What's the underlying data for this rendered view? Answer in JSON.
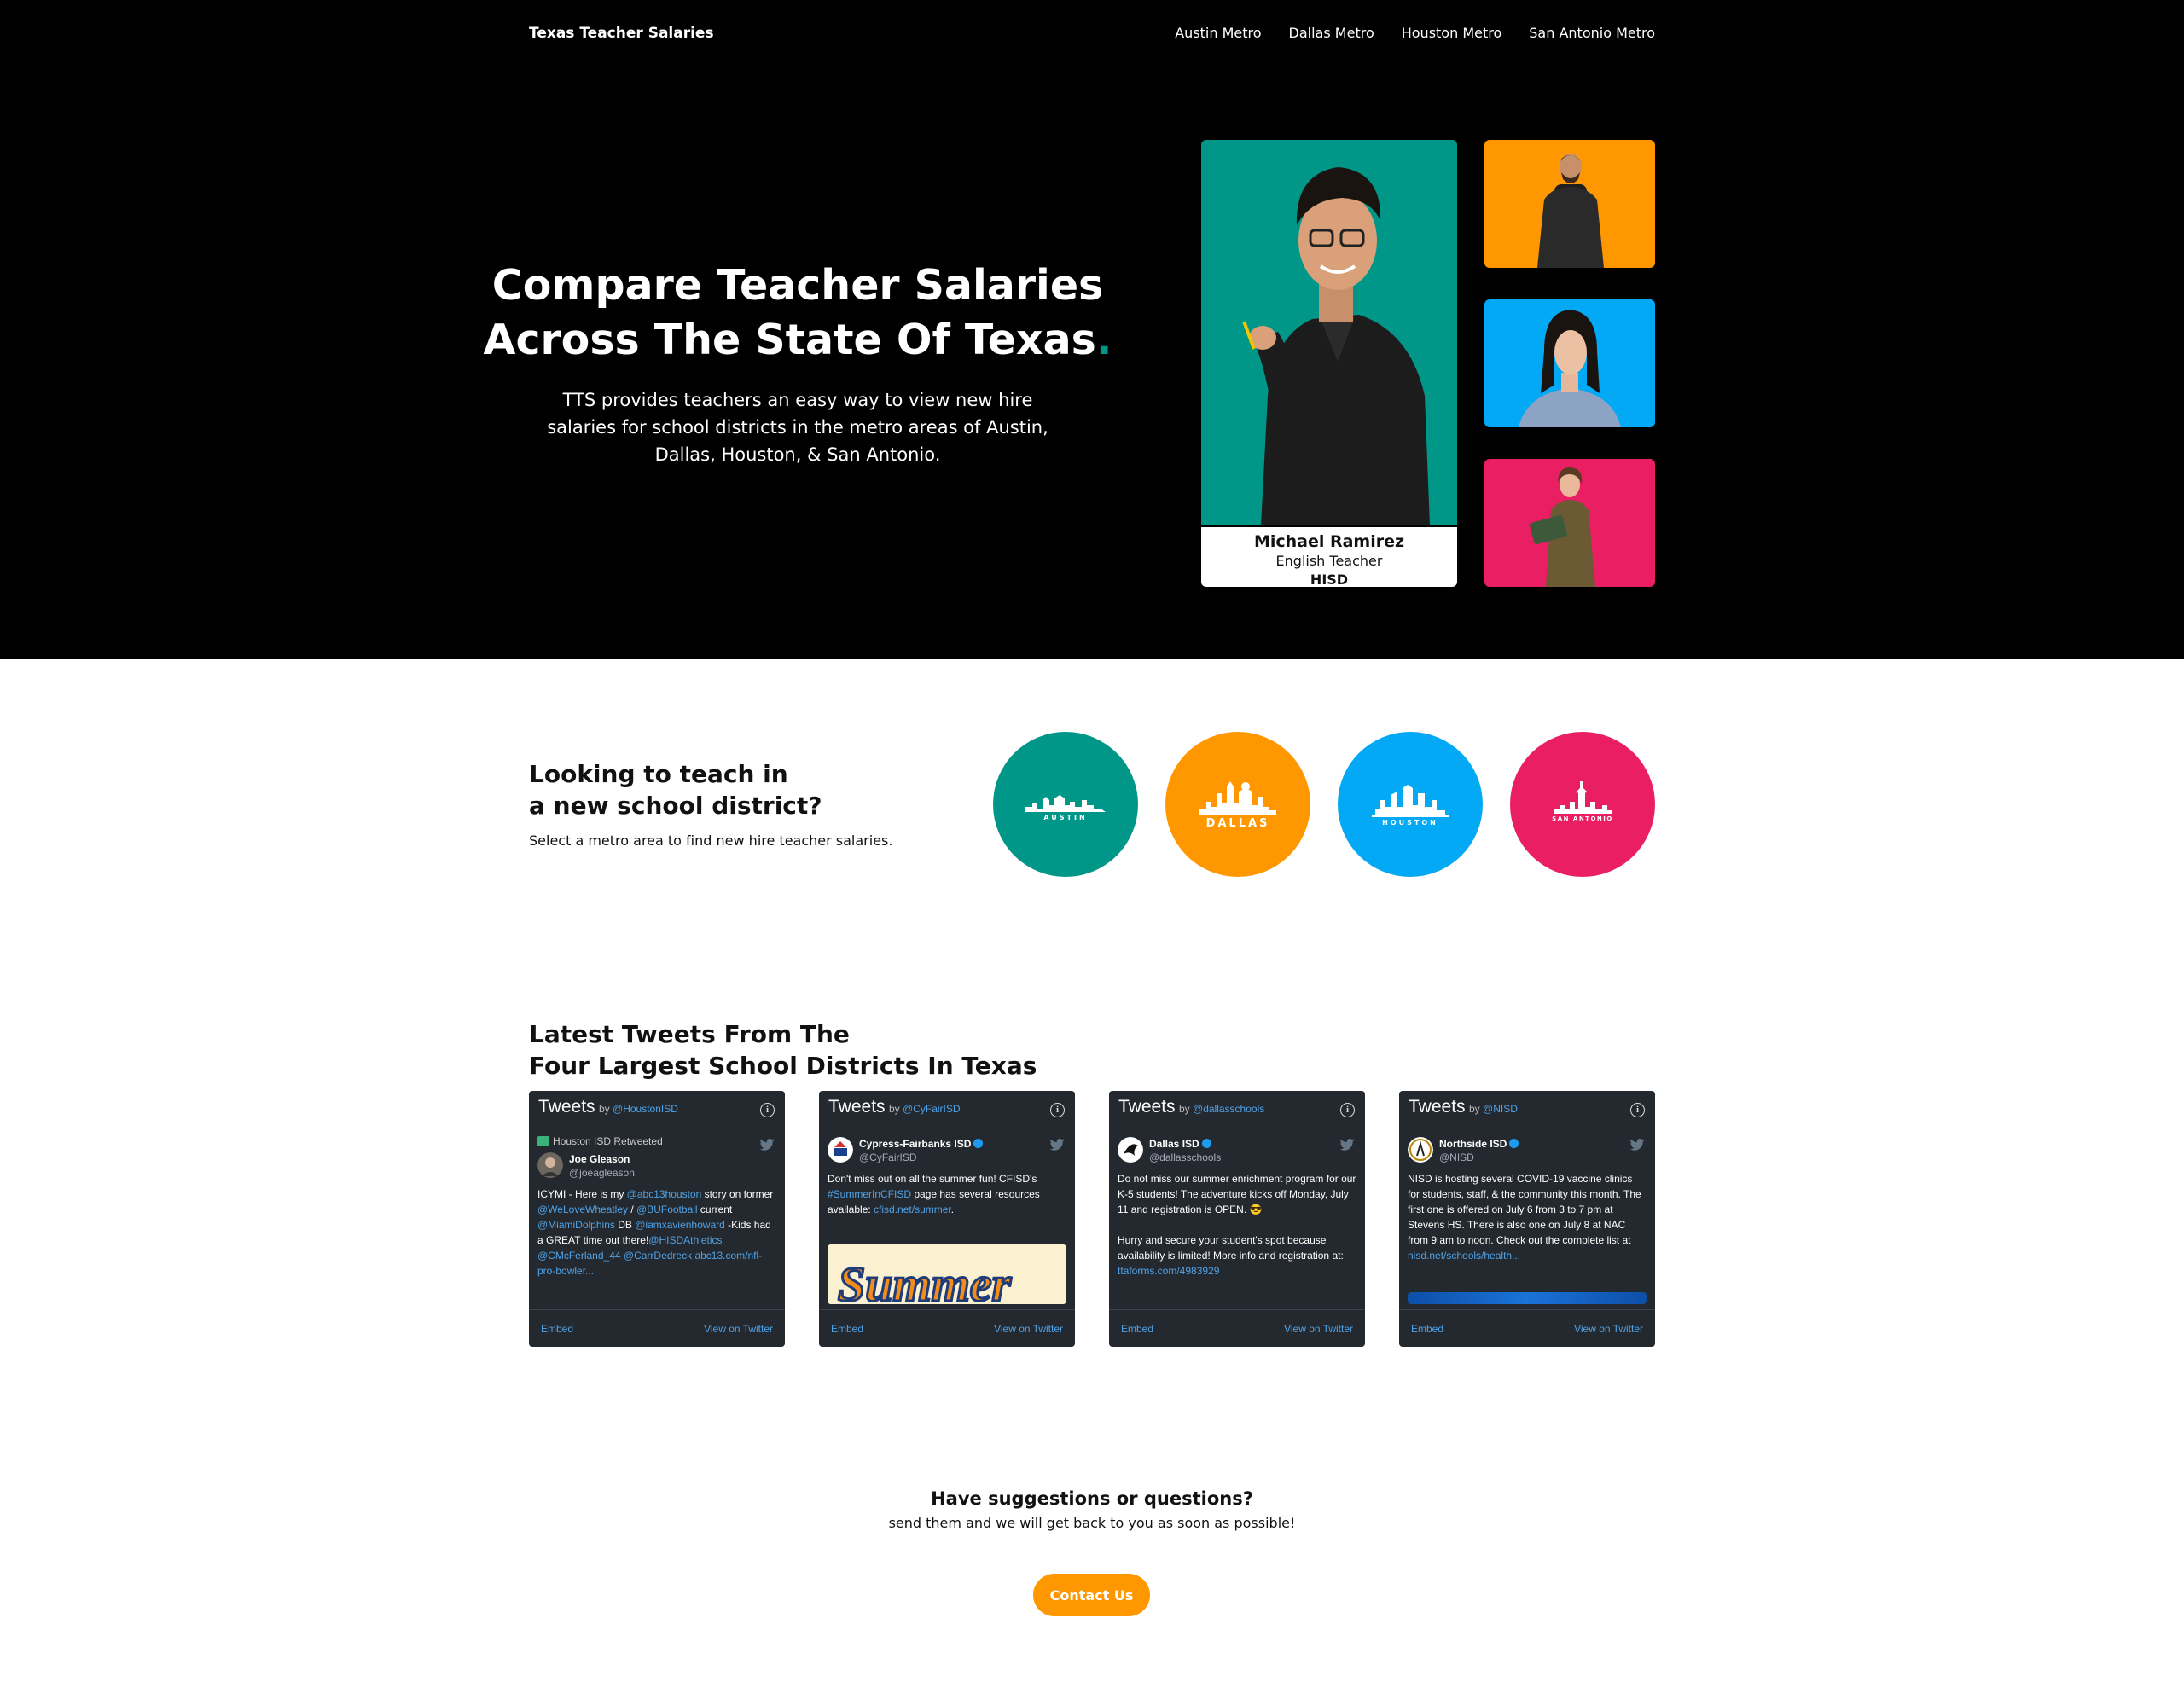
{
  "header": {
    "brand": "Texas Teacher Salaries",
    "nav": [
      "Austin Metro",
      "Dallas Metro",
      "Houston Metro",
      "San Antonio Metro"
    ]
  },
  "hero": {
    "title_line1": "Compare Teacher Salaries",
    "title_line2": "Across The State Of Texas",
    "title_dot": ".",
    "subtitle": "TTS provides teachers an easy way to view new hire salaries for school districts in the metro areas of Austin, Dallas, Houston, & San Antonio.",
    "featured": {
      "name": "Michael Ramirez",
      "role": "English Teacher",
      "district": "HISD"
    },
    "colors": {
      "teal": "#009688",
      "orange": "#ff9800",
      "blue": "#03a9f4",
      "pink": "#e91e63"
    }
  },
  "metro": {
    "title_line1": "Looking to teach in",
    "title_line2": "a new school district?",
    "subtitle": "Select a metro area to find new hire teacher salaries.",
    "cities": [
      "AUSTIN",
      "DALLAS",
      "HOUSTON",
      "SAN ANTONIO"
    ]
  },
  "tweets": {
    "title_line1": "Latest Tweets From The",
    "title_line2": "Four Largest School Districts In Texas",
    "header_word": "Tweets",
    "by_word": "by",
    "embed_label": "Embed",
    "view_label": "View on Twitter",
    "cards": [
      {
        "handle": "@HoustonISD",
        "retweet_line": "Houston ISD Retweeted",
        "name": "Joe Gleason",
        "user": "@joeagleason",
        "text_parts": [
          "ICYMI - Here is my ",
          "@abc13houston",
          " story on former ",
          "@WeLoveWheatley",
          " / ",
          "@BUFootball",
          " current ",
          "@MiamiDolphins",
          " DB ",
          "@iamxavienhoward",
          " -Kids had a GREAT time out there!",
          "@HISDAthletics",
          " ",
          "@CMcFerland_44",
          " ",
          "@CarrDedreck",
          " ",
          "abc13.com/nfl-pro-bowler..."
        ]
      },
      {
        "handle": "@CyFairISD",
        "name": "Cypress-Fairbanks ISD",
        "user": "@CyFairISD",
        "text_parts": [
          "Don't miss out on all the summer fun! CFISD's ",
          "#SummerInCFISD",
          " page has several resources available: ",
          "cfisd.net/summer",
          "."
        ],
        "media_text": "Summer"
      },
      {
        "handle": "@dallasschools",
        "name": "Dallas ISD",
        "user": "@dallasschools",
        "text_parts": [
          "Do not miss our summer enrichment program for our K-5 students! The adventure kicks off Monday, July 11 and registration is OPEN. 😎",
          "Hurry and secure your student's spot because availability is limited! More info and registration at: ",
          "ttaforms.com/4983929"
        ]
      },
      {
        "handle": "@NISD",
        "name": "Northside ISD",
        "user": "@NISD",
        "text_parts": [
          "NISD is hosting several COVID-19 vaccine clinics for students, staff, & the community this month. The first one is offered on July 6 from 3 to 7 pm at Stevens HS. There is also one on July 8 at NAC from 9 am to noon. Check out the complete list at ",
          "nisd.net/schools/health..."
        ]
      }
    ]
  },
  "contact": {
    "title": "Have suggestions or questions?",
    "subtitle": "send them and we will get back to you as soon as possible!",
    "button": "Contact Us"
  }
}
